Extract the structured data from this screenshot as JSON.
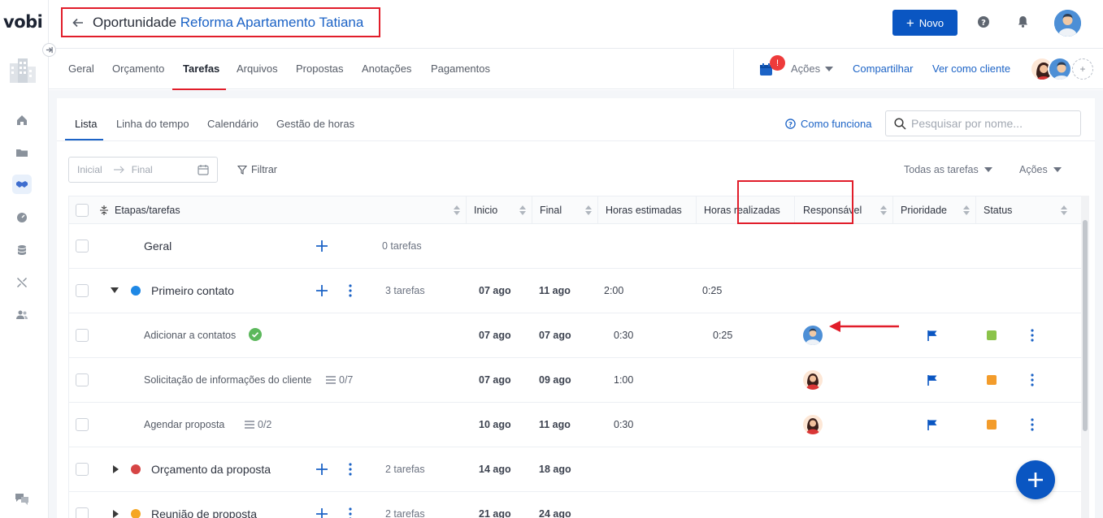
{
  "app": {
    "logo": "vobi"
  },
  "header": {
    "title_prefix": "Oportunidade",
    "title_name": "Reforma Apartamento Tatiana",
    "novo_label": "Novo"
  },
  "tabs": [
    "Geral",
    "Orçamento",
    "Tarefas",
    "Arquivos",
    "Propostas",
    "Anotações",
    "Pagamentos"
  ],
  "tabs_right": {
    "badge": "!",
    "acoes": "Ações",
    "compartilhar": "Compartilhar",
    "ver_como_cliente": "Ver como cliente",
    "team_add": "+"
  },
  "subtabs": [
    "Lista",
    "Linha do tempo",
    "Calendário",
    "Gestão de horas"
  ],
  "como_funciona": "Como funciona",
  "search": {
    "placeholder": "Pesquisar por nome..."
  },
  "filters": {
    "start_placeholder": "Inicial",
    "end_placeholder": "Final",
    "filtrar": "Filtrar",
    "todas_tarefas": "Todas as tarefas",
    "acoes": "Ações"
  },
  "columns": [
    "Etapas/tarefas",
    "Inicio",
    "Final",
    "Horas estimadas",
    "Horas realizadas",
    "Responsável",
    "Prioridade",
    "Status"
  ],
  "rows": [
    {
      "type": "stage",
      "name": "Geral",
      "count": "0 tarefas",
      "expanded": false,
      "color": "",
      "start": "",
      "end": "",
      "est": "",
      "real": ""
    },
    {
      "type": "stage",
      "name": "Primeiro contato",
      "count": "3 tarefas",
      "expanded": true,
      "color": "#1e88e5",
      "start": "07 ago",
      "end": "11 ago",
      "est": "2:00",
      "real": "0:25"
    },
    {
      "type": "task",
      "name": "Adicionar a contatos",
      "done": true,
      "checklist": "",
      "start": "07 ago",
      "end": "07 ago",
      "est": "0:30",
      "real": "0:25",
      "assignee": "man",
      "priority_color": "#0a56c2",
      "status_color": "#8bc34a"
    },
    {
      "type": "task",
      "name": "Solicitação de informações do cliente",
      "done": false,
      "checklist": "0/7",
      "start": "07 ago",
      "end": "09 ago",
      "est": "1:00",
      "real": "",
      "assignee": "woman",
      "priority_color": "#0a56c2",
      "status_color": "#f39c2b"
    },
    {
      "type": "task",
      "name": "Agendar proposta",
      "done": false,
      "checklist": "0/2",
      "start": "10 ago",
      "end": "11 ago",
      "est": "0:30",
      "real": "",
      "assignee": "woman",
      "priority_color": "#0a56c2",
      "status_color": "#f39c2b"
    },
    {
      "type": "stage",
      "name": "Orçamento da proposta",
      "count": "2 tarefas",
      "expanded": false,
      "color": "#d64545",
      "start": "14 ago",
      "end": "18 ago",
      "est": "",
      "real": ""
    },
    {
      "type": "stage",
      "name": "Reunião de proposta",
      "count": "2 tarefas",
      "expanded": false,
      "color": "#f5a623",
      "start": "21 ago",
      "end": "24 ago",
      "est": "",
      "real": ""
    }
  ],
  "colors": {
    "accent": "#0a56c2",
    "link": "#1c63c6",
    "highlight": "#e11d2a"
  }
}
